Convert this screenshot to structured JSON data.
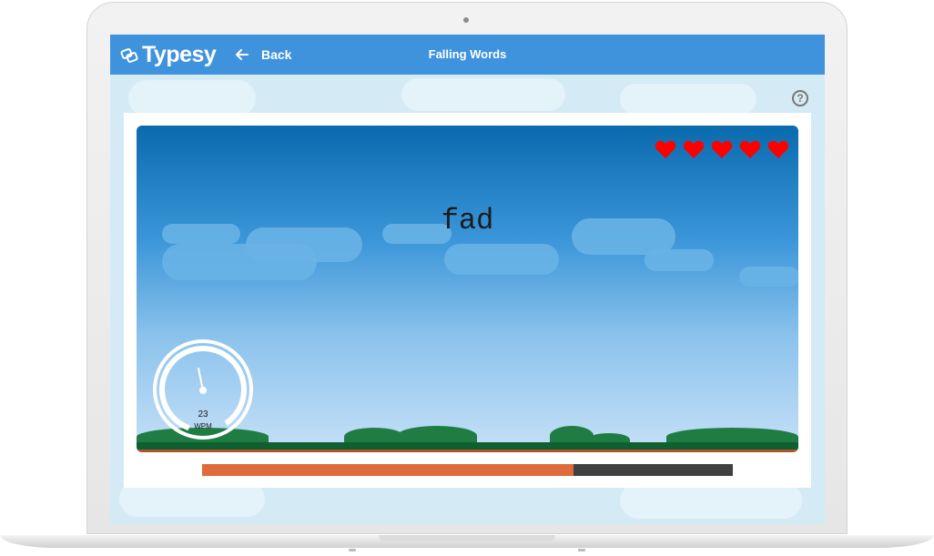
{
  "app": {
    "brand": "Typesy",
    "back_label": "Back",
    "title": "Falling Words"
  },
  "game": {
    "current_word": "fad",
    "lives": 5,
    "wpm": "23",
    "wpm_unit": "WPM",
    "progress": 0.7
  },
  "icons": {
    "logo": "typesy-logo-icon",
    "back": "arrow-left-icon",
    "help": "help-circle-icon",
    "life": "heart-icon"
  },
  "colors": {
    "header": "#3f93dd",
    "heart": "#ff0000",
    "progress_fill": "#e06b3a",
    "progress_track": "#404040",
    "grass": "#1f7d43"
  }
}
